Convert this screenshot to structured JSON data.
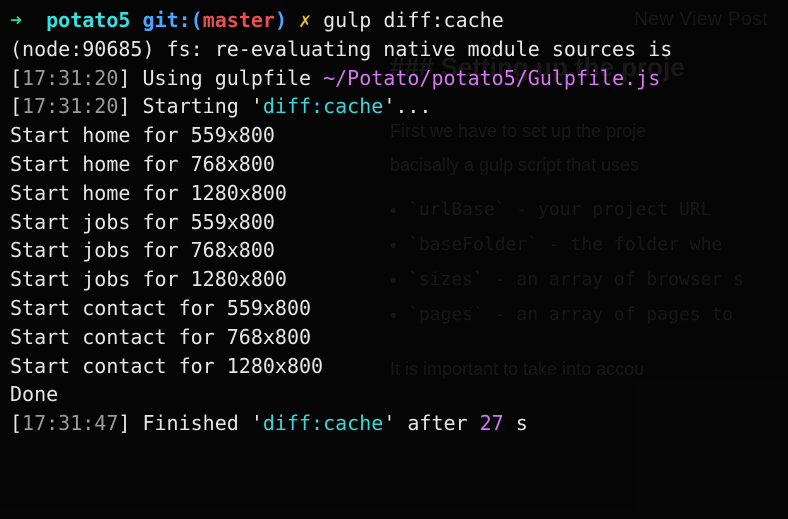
{
  "backdrop": {
    "nav": "New   View Post",
    "heading": "### Setting up the proje",
    "p1a": "First we have to set up the proje",
    "p1b": "bacisally a gulp script that uses ",
    "li1": "`urlBase` - your project URL",
    "li2": "`baseFolder` - the folder whe",
    "li3": "`sizes` - an array of browser s",
    "li4": "`pages` - an array of pages to",
    "p2": "It is important to take into accou"
  },
  "prompt": {
    "arrow": "➜",
    "dir": "potato5",
    "gitlabel": "git:(",
    "branch": "master",
    "gitclose": ")",
    "dirty": "✗",
    "command": "gulp diff:cache"
  },
  "l1": "(node:90685) fs: re-evaluating native module sources is ",
  "l2": {
    "ts": "17:31:20",
    "a": "Using gulpfile ",
    "path": "~/Potato/potato5/Gulpfile.js"
  },
  "l3": {
    "ts": "17:31:20",
    "a": "Starting '",
    "task": "diff:cache",
    "b": "'..."
  },
  "runs": [
    "Start home for 559x800",
    "Start home for 768x800",
    "Start home for 1280x800",
    "Start jobs for 559x800",
    "Start jobs for 768x800",
    "Start jobs for 1280x800",
    "Start contact for 559x800",
    "Start contact for 768x800",
    "Start contact for 1280x800"
  ],
  "done": "Done",
  "l_end": {
    "ts": "17:31:47",
    "a": "Finished '",
    "task": "diff:cache",
    "b": "' after ",
    "dur": "27",
    "unit": " s"
  }
}
